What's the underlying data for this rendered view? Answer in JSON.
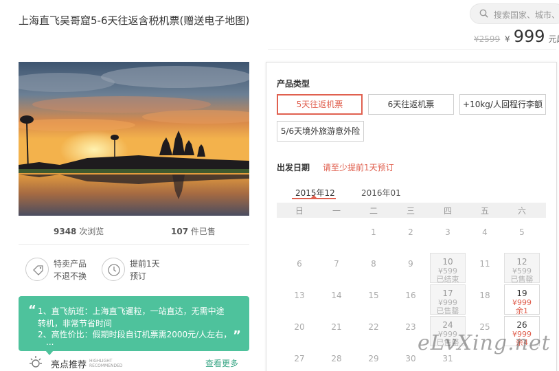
{
  "header": {
    "title": "上海直飞吴哥窟5-6天往返含税机票(赠送电子地图)",
    "search_placeholder": "搜索国家、城市、"
  },
  "price": {
    "original": "¥2599",
    "currency": "¥",
    "current": "999",
    "unit": "元起"
  },
  "stats": {
    "views_num": "9348",
    "views_label": " 次浏览",
    "sold_num": "107",
    "sold_label": " 件已售"
  },
  "features": [
    {
      "line1": "特卖产品",
      "line2": "不退不换",
      "icon": "tag-icon"
    },
    {
      "line1": "提前1天",
      "line2": "预订",
      "icon": "clock-icon"
    }
  ],
  "highlights_box": {
    "lines": [
      "1、直飞航班：上海直飞暹粒，一站直达，无需中途",
      "转机，非常节省时间",
      "2、高性价比：假期时段自订机票需2000元/人左右，",
      "..."
    ]
  },
  "highlight_section": {
    "title": "亮点推荐",
    "en_line1": "HIGHLIGHT",
    "en_line2": "RECOMMENDED",
    "more": "查看更多"
  },
  "panel": {
    "product_type_label": "产品类型",
    "options": [
      {
        "label": "5天往返机票",
        "selected": true
      },
      {
        "label": "6天往返机票",
        "selected": false
      },
      {
        "label": "+10kg/人回程行李额",
        "selected": false
      },
      {
        "label": "5/6天境外旅游意外险",
        "selected": false
      }
    ],
    "departure_label": "出发日期",
    "departure_notice": "请至少提前1天预订",
    "months": [
      "2015年12",
      "2016年01"
    ],
    "weekdays": [
      "日",
      "一",
      "二",
      "三",
      "四",
      "五",
      "六"
    ],
    "calendar": [
      {
        "day": "1"
      },
      {
        "day": "2"
      },
      {
        "day": "3"
      },
      {
        "day": "4"
      },
      {
        "day": "5"
      },
      {
        "day": "6"
      },
      {
        "day": "7"
      },
      {
        "day": "8"
      },
      {
        "day": "9"
      },
      {
        "day": "10",
        "price": "¥599",
        "status": "已结束"
      },
      {
        "day": "11"
      },
      {
        "day": "12",
        "price": "¥599",
        "status": "已售罄"
      },
      {
        "day": "13"
      },
      {
        "day": "14"
      },
      {
        "day": "15"
      },
      {
        "day": "16"
      },
      {
        "day": "17",
        "price": "¥999",
        "status": "已售罄"
      },
      {
        "day": "18"
      },
      {
        "day": "19",
        "price": "¥999",
        "status": "余1"
      },
      {
        "day": "20"
      },
      {
        "day": "21"
      },
      {
        "day": "22"
      },
      {
        "day": "23"
      },
      {
        "day": "24",
        "price": "¥999",
        "status": "已售罄"
      },
      {
        "day": "25"
      },
      {
        "day": "26",
        "price": "¥999",
        "status": "余4"
      },
      {
        "day": "27"
      },
      {
        "day": "28"
      },
      {
        "day": "29"
      },
      {
        "day": "30"
      },
      {
        "day": "31"
      }
    ]
  },
  "watermark": "eLvXing.net",
  "colors": {
    "accent": "#e0604f",
    "green": "#4ec29c"
  }
}
